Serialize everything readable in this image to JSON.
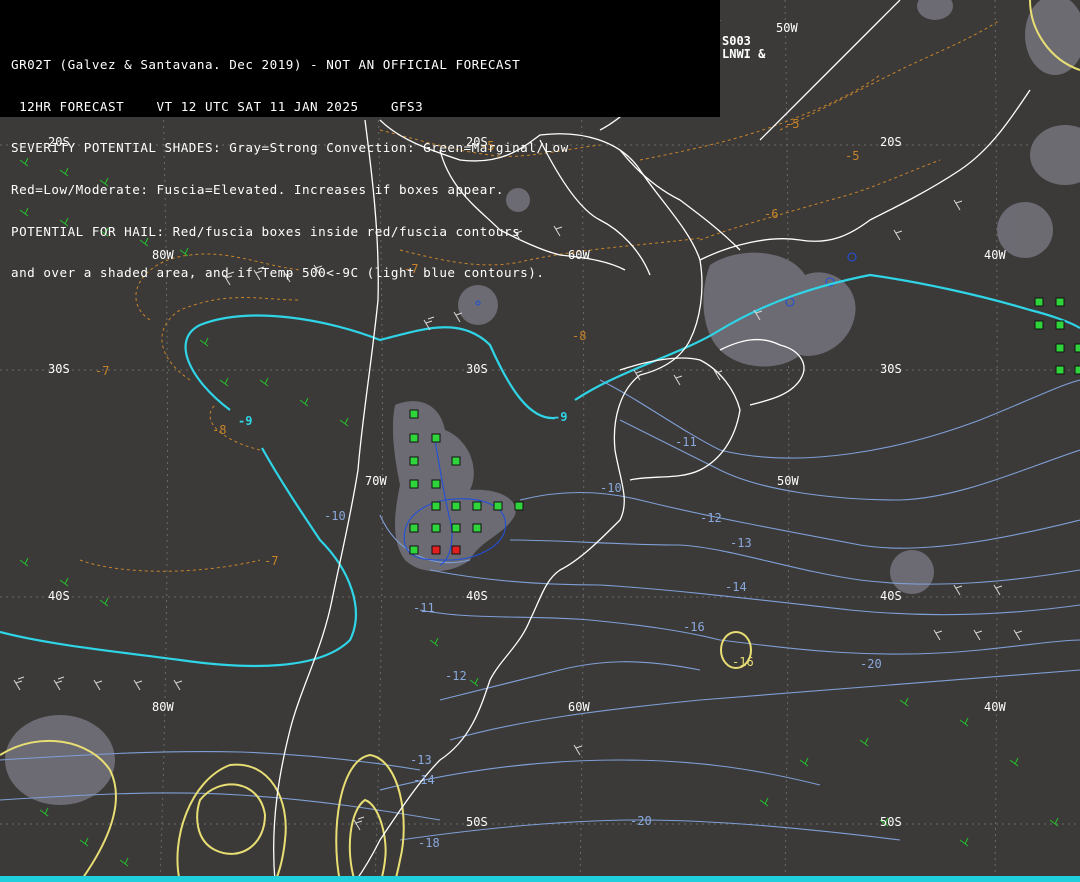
{
  "header": {
    "lines": [
      "GR02T (Galvez & Santavana. Dec 2019) - NOT AN OFFICIAL FORECAST",
      " 12HR FORECAST    VT 12 UTC SAT 11 JAN 2025    GFS3",
      "SEVERITY POTENTIAL SHADES: Gray=Strong Convection: Green=Marginal/Low",
      "Red=Low/Moderate: Fuscia=Elevated. Increases if boxes appear.",
      "POTENTIAL FOR HAIL: Red/fuscia boxes inside red/fuscia contours",
      "and over a shaded area, and if Temp 500<-9C (light blue contours)."
    ],
    "corner_code": "S003",
    "corner_code2": "LNWI &"
  },
  "latitude_labels": [
    "20S",
    "20S",
    "20S",
    "30S",
    "30S",
    "30S",
    "40S",
    "40S",
    "40S",
    "50S",
    "50S"
  ],
  "longitude_labels": [
    "80W",
    "60W",
    "40W",
    "70W",
    "50W",
    "80W",
    "60W",
    "40W",
    "50W"
  ],
  "temp_500_labels": [
    "-9",
    "-9",
    "-10",
    "-10",
    "-11",
    "-11",
    "-12",
    "-12",
    "-13",
    "-13",
    "-14",
    "-14",
    "-16",
    "-20",
    "-20",
    "-18"
  ],
  "orange_contour_labels": [
    "-5",
    "-5",
    "-6",
    "-7",
    "-7",
    "-8",
    "-8",
    "-5",
    "-7"
  ],
  "yellow_labels": [
    "-16"
  ],
  "colors": {
    "background": "#3b3a38",
    "coastline": "#ffffff",
    "temp_contour_light_blue": "#8aa9dd",
    "minus9_contour": "#2fd4e6",
    "orange_dashed": "#c8842a",
    "yellow_contour": "#e8de74",
    "gray_shade": "#6f6e76",
    "green_box": "#2fd43a",
    "red_box": "#e21e1e",
    "wind_barb_white": "#d8d8d8",
    "wind_barb_green": "#23c02a",
    "bottom_bar": "#1fd0dc"
  }
}
